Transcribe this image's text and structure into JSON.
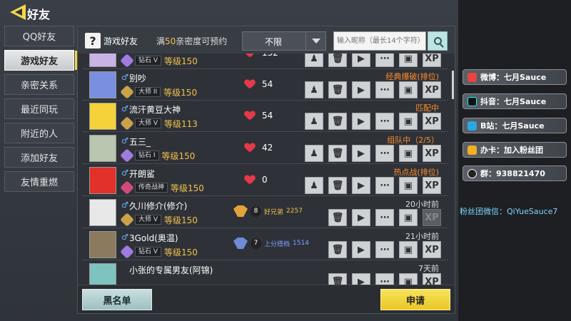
{
  "header": {
    "title": "好友"
  },
  "tabs": [
    {
      "label": "QQ好友"
    },
    {
      "label": "游戏好友"
    },
    {
      "label": "亲密关系"
    },
    {
      "label": "最近同玩"
    },
    {
      "label": "附近的人"
    },
    {
      "label": "添加好友"
    },
    {
      "label": "友情重燃"
    }
  ],
  "panel": {
    "title": "游戏好友",
    "intimacy_prefix": "满",
    "intimacy_num": "50",
    "intimacy_suffix": "亲密度可预约",
    "filter_value": "不限",
    "search_placeholder": "输入昵称（最长14个字符）"
  },
  "friends": [
    {
      "name": "",
      "gender": "",
      "rank": "钻石 V",
      "level": "等级150",
      "intimacy": "132",
      "status": "",
      "avatar_color": "#c9b2e6"
    },
    {
      "name": "别吵",
      "gender": "♂",
      "rank": "大师 II",
      "level": "等级150",
      "intimacy": "54",
      "status": "经典爆破(排位)",
      "avatar_color": "#7b8fe0"
    },
    {
      "name": "流汗黄豆大神",
      "gender": "♂",
      "rank": "大师 V",
      "level": "等级113",
      "intimacy": "54",
      "status": "匹配中",
      "avatar_color": "#f5d13a"
    },
    {
      "name": "五三_",
      "gender": "♂",
      "rank": "钻石 I",
      "level": "等级150",
      "intimacy": "42",
      "status": "组队中（2/5）",
      "avatar_color": "#b9c6b0"
    },
    {
      "name": "开朗鲨",
      "gender": "♂",
      "rank": "传奇战神",
      "level": "等级150",
      "intimacy": "0",
      "status": "热点战(排位)",
      "avatar_color": "#e2302a"
    },
    {
      "name": "久川修介(修介)",
      "gender": "♂",
      "rank": "大师 V",
      "level": "等级150",
      "clan_num": "8",
      "clan_name": "好兄弟",
      "clan_score": "2257",
      "status": "20小时前",
      "avatar_color": "#e8e8e8"
    },
    {
      "name": "3Gold(奥温)",
      "gender": "♂",
      "rank": "钻石 V",
      "level": "等级150",
      "clan_num": "7",
      "clan_name": "上分搭档",
      "clan_score": "1514",
      "status": "21小时前",
      "avatar_color": "#8c7a5e"
    },
    {
      "name": "小张的专属男友(阿锦)",
      "gender": "",
      "rank": "",
      "level": "",
      "status": "7天前",
      "avatar_color": "#7fc3c0"
    }
  ],
  "buttons": {
    "blacklist": "黑名单",
    "apply": "申请"
  },
  "stream_overlay": {
    "weibo": "微博：七月Sauce",
    "douyin": "抖音：七月Sauce",
    "bilibili": "B站：七月Sauce",
    "card": "办卡：加入粉丝团",
    "group": "群：938821470",
    "fans": "粉丝团微信：QiYueSauce7"
  },
  "colors": {
    "accent_yellow": "#f3d64a",
    "status_orange": "#ff8a2a",
    "heart_red": "#e5394a"
  }
}
